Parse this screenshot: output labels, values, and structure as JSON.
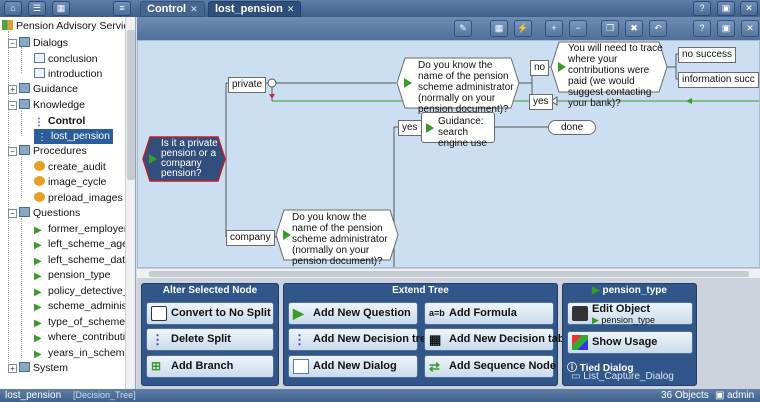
{
  "toolbar": {
    "menu_icon": "menu-icon",
    "tabs": [
      {
        "label": "Control"
      },
      {
        "label": "lost_pension"
      }
    ]
  },
  "tree": {
    "root": "Pension Advisory Service",
    "dialogs": "Dialogs",
    "conclusion": "conclusion",
    "introduction": "introduction",
    "guidance": "Guidance",
    "knowledge": "Knowledge",
    "control": "Control",
    "lost_pension": "lost_pension",
    "procedures": "Procedures",
    "create_audit": "create_audit",
    "image_cycle": "image_cycle",
    "preload_images": "preload_images",
    "questions": "Questions",
    "q1": "former_employer_",
    "q2": "left_scheme_age",
    "q3": "left_scheme_date",
    "q4": "pension_type",
    "q5": "policy_detective_w",
    "q6": "scheme_administr",
    "q7": "type_of_scheme",
    "q8": "where_contributio",
    "q9": "years_in_scheme",
    "system": "System"
  },
  "canvas": {
    "root_q": "Is it a private pension or a company pension?",
    "private": "private",
    "company": "company",
    "q_admin_top": "Do you know the name of the pension scheme administrator (normally on your pension document)?",
    "q_admin_bottom": "Do you know the name of the pension scheme administrator (normally on your pension document)?",
    "no": "no",
    "yes_top": "yes",
    "yes_mid": "yes",
    "trace": "You will need to trace where your contributions were paid (we would suggest contacting your bank)?",
    "no_success": "no success",
    "info_success": "information succ",
    "guidance": "Guidance: search engine use",
    "done": "done"
  },
  "panels": {
    "alter_title": "Alter Selected Node",
    "convert": "Convert to No Split",
    "delete": "Delete Split",
    "add_branch": "Add Branch",
    "extend_title": "Extend Tree",
    "add_question": "Add New Question",
    "add_formula": "Add Formula",
    "add_tree": "Add New Decision tree",
    "add_table": "Add New Decision table",
    "add_dialog": "Add New Dialog",
    "add_sequence": "Add Sequence Node",
    "obj_title": "pension_type",
    "edit_object": "Edit Object",
    "edit_sub": "pension_type",
    "show_usage": "Show Usage",
    "tied_dialog": "Tied Dialog",
    "tied_item": "List_Capture_Dialog"
  },
  "status": {
    "node": "lost_pension",
    "node_type": "[Decision_Tree]",
    "objects": "36 Objects",
    "user": "admin"
  }
}
